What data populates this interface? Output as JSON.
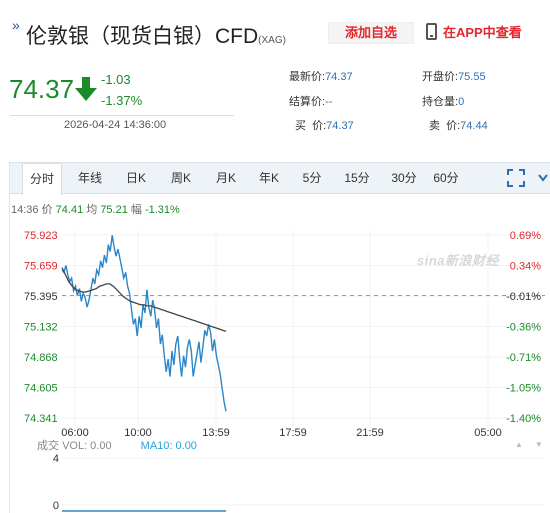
{
  "header": {
    "title": "伦敦银（现货白银）CFD",
    "code": "(XAG)",
    "watchlist_label": "添加自选",
    "app_label": "在APP中查看"
  },
  "quote": {
    "price": "74.37",
    "change": "-1.03",
    "change_pct": "-1.37%",
    "datetime": "2026-04-24 14:36:00"
  },
  "stats": {
    "latest_label": "最新价:",
    "latest_value": "74.37",
    "open_label": "开盘价:",
    "open_value": "75.55",
    "settle_label": "结算价:",
    "settle_value": "--",
    "position_label": "持仓量:",
    "position_value": "0",
    "bid_label": "买  价:",
    "bid_value": "74.37",
    "ask_label": "卖  价:",
    "ask_value": "74.44"
  },
  "tabs": [
    "分时",
    "年线",
    "日K",
    "周K",
    "月K",
    "年K",
    "5分",
    "15分",
    "30分",
    "60分"
  ],
  "active_tab": 0,
  "info": {
    "time": "14:36",
    "price_label": "价",
    "price": "74.41",
    "avg_label": "均",
    "avg": "75.21",
    "amp_label": "幅",
    "amp": "-1.31%"
  },
  "watermark": "sina新浪财经",
  "volume": {
    "label": "成交",
    "vol_text": "VOL: 0.00",
    "ma_text": "MA10: 0.00",
    "axis_labels": [
      "4",
      "0"
    ]
  },
  "colors": {
    "up": "#e4272d",
    "down": "#1b8b2a",
    "price_line": "#2a86c9",
    "avg_line": "#444444",
    "accent_blue": "#2f6fb0"
  },
  "chart_data": {
    "type": "line",
    "title": "",
    "x_ticks": [
      "06:00",
      "10:00",
      "13:59",
      "17:59",
      "21:59",
      "05:00"
    ],
    "y_ticks_price": [
      "75.923",
      "75.659",
      "75.395",
      "75.132",
      "74.868",
      "74.605",
      "74.341"
    ],
    "y_ticks_pct": [
      "0.69%",
      "0.34%",
      "-0.01%",
      "-0.36%",
      "-0.71%",
      "-1.05%",
      "-1.40%"
    ],
    "ylim": [
      74.341,
      75.923
    ],
    "reference_price": 75.4,
    "series": [
      {
        "values": [
          75.62,
          75.6,
          75.66,
          75.58,
          75.52,
          75.55,
          75.44,
          75.48,
          75.4,
          75.46,
          75.35,
          75.42,
          75.38,
          75.3,
          75.36,
          75.45,
          75.55,
          75.5,
          75.62,
          75.58,
          75.7,
          75.64,
          75.75,
          75.68,
          75.84,
          75.78,
          75.92,
          75.82,
          75.74,
          75.8,
          75.72,
          75.64,
          75.55,
          75.6,
          75.48,
          75.42,
          75.28,
          75.15,
          75.2,
          75.05,
          75.22,
          75.12,
          75.32,
          75.25,
          75.45,
          75.3,
          75.22,
          75.36,
          75.28,
          75.12,
          75.2,
          74.98,
          75.06,
          74.88,
          74.74,
          74.85,
          74.7,
          74.92,
          74.8,
          74.98,
          75.05,
          74.85,
          74.7,
          74.88,
          74.78,
          74.95,
          75.02,
          74.92,
          74.7,
          74.8,
          74.9,
          75.0,
          74.82,
          74.95,
          75.1,
          75.05,
          75.15,
          75.08,
          74.92,
          75.02,
          74.88,
          74.8,
          74.72,
          74.6,
          74.48,
          74.4
        ]
      },
      {
        "values": [
          75.64,
          75.58,
          75.52,
          75.48,
          75.45,
          75.44,
          75.43,
          75.43,
          75.44,
          75.45,
          75.46,
          75.48,
          75.49,
          75.5,
          75.5,
          75.48,
          75.45,
          75.42,
          75.39,
          75.37,
          75.35,
          75.34,
          75.33,
          75.32,
          75.32,
          75.31,
          75.31,
          75.3,
          75.29,
          75.28,
          75.27,
          75.26,
          75.25,
          75.24,
          75.23,
          75.22,
          75.21,
          75.2,
          75.19,
          75.18,
          75.17,
          75.16,
          75.15,
          75.14,
          75.13,
          75.12,
          75.11,
          75.1,
          75.09
        ]
      }
    ],
    "volume": {
      "ylim": [
        0,
        4
      ],
      "values": []
    }
  }
}
